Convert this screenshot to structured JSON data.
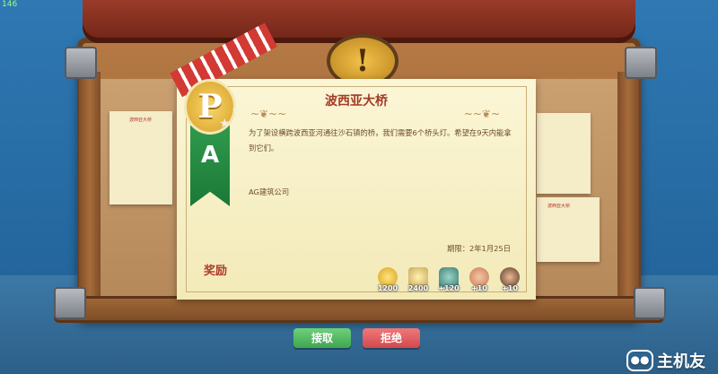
{
  "fps": "146",
  "board": {
    "emblem": "!"
  },
  "side_notes": {
    "left_title": "波西亚大桥",
    "right_title": "波西亚大桥"
  },
  "quest": {
    "title": "波西亚大桥",
    "description": "为了架设横跨波西亚河通往沙石镇的桥，我们需要6个桥头灯。希望在9天内能拿到它们。",
    "company": "AG建筑公司",
    "deadline": "期限：2年1月25日",
    "reward_label": "奖励",
    "rank_letter": "A",
    "badge_letter": "P",
    "rewards": [
      {
        "icon": "coin-icon",
        "value": "1200"
      },
      {
        "icon": "exp-icon",
        "value": "2400"
      },
      {
        "icon": "workshop-icon",
        "value": "+120"
      },
      {
        "icon": "npc-face-icon",
        "value": "+10"
      },
      {
        "icon": "npc-face-icon",
        "value": "+10"
      }
    ]
  },
  "buttons": {
    "accept": "接取",
    "decline": "拒绝"
  },
  "watermark": {
    "text": "主机友"
  },
  "colors": {
    "accent_red": "#b03a2e",
    "accept_green": "#4fbb5f",
    "decline_red": "#e05a5e"
  }
}
